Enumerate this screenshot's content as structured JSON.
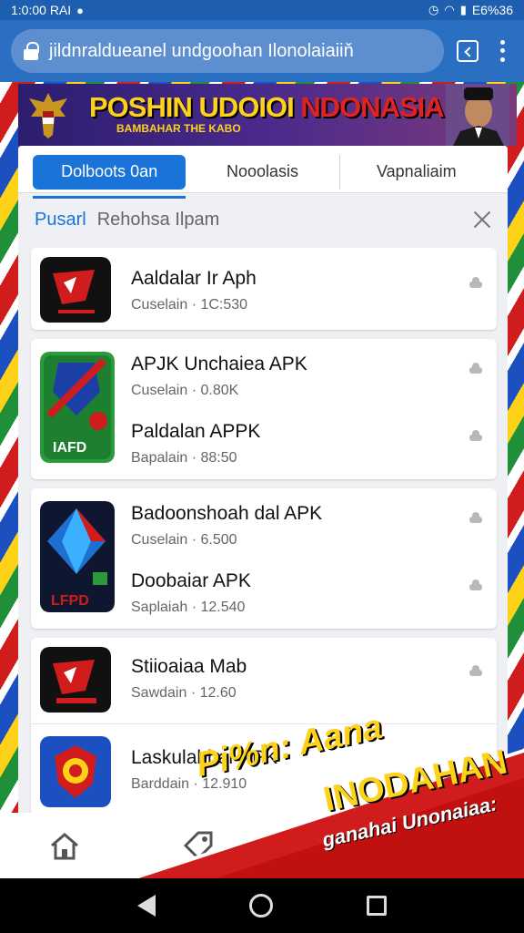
{
  "status_bar": {
    "time": "1:0:00 RAI",
    "right_text": "E6%36"
  },
  "browser": {
    "url": "jildnraldueanel undgoohan Ilonolaiaiiň",
    "icons": [
      "lock-icon",
      "tabs-icon",
      "overflow-menu-icon"
    ]
  },
  "banner": {
    "title_main": "POSHIN UDOIOI ",
    "title_accent": "NDONASIA",
    "subtitle": "BAMBAHAR THE KABO",
    "colors": {
      "title": "#ffd21a",
      "accent": "#e02222"
    }
  },
  "tabs": [
    {
      "label": "Dolboots 0an",
      "active": true
    },
    {
      "label": "Nooolasis",
      "active": false
    },
    {
      "label": "Vapnaliaim",
      "active": false
    }
  ],
  "search": {
    "scope": "Pusarl",
    "query": "Rehohsa Ilpam"
  },
  "apps": [
    {
      "name": "Aaldalar Ir Aph",
      "meta": "Cuselain · 1C:530"
    },
    {
      "name": "APJK Unchaiea APK",
      "meta": "Cuselain · 0.80K"
    },
    {
      "name": "Paldalan APPK",
      "meta": "Bapalain · 88:50"
    },
    {
      "name": "Badoonshoah dal APK",
      "meta": "Cuselain · 6.500"
    },
    {
      "name": "Doobaiar APK",
      "meta": "Saplaiah · 12.540"
    },
    {
      "name": "Stiioaiaa Mab",
      "meta": "Sawdain · 12.60"
    },
    {
      "name": "Laskulabhar APK",
      "meta": "Barddain · 12.910"
    }
  ],
  "icon_labels": {
    "green_badge": "IAFD",
    "dark_badge": "LFPD"
  },
  "promo": {
    "line1": "Pi%n: Aana",
    "line2": "INODAHAN",
    "line3": "ganahai Unonaiaa:"
  }
}
